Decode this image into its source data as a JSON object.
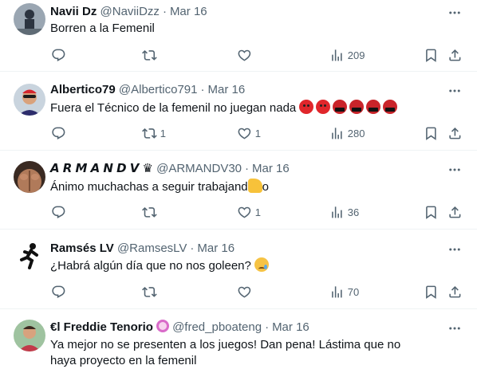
{
  "tweets": [
    {
      "name": "Navii Dz",
      "handle": "@NaviiDzz",
      "date": "Mar 16",
      "text": "Borren a la Femenil",
      "stats": {
        "replies": "",
        "retweets": "",
        "likes": "",
        "views": "209"
      },
      "avatar_colors": [
        "#7d8a98",
        "#2c3440"
      ]
    },
    {
      "name": "Albertico79",
      "handle": "@Albertico791",
      "date": "Mar 16",
      "text": "Fuera el Técnico de la femenil no juegan nada",
      "emojis": [
        "angry-face",
        "angry-face",
        "cursing-face",
        "cursing-face",
        "cursing-face",
        "cursing-face"
      ],
      "stats": {
        "replies": "",
        "retweets": "1",
        "likes": "1",
        "views": "280"
      },
      "avatar_colors": [
        "#c9d4de",
        "#2c2c6b"
      ]
    },
    {
      "name": "𝘼 𝙍 𝙈 𝘼 𝙉 𝘿 𝙑 ♛",
      "handle": "@ARMANDV30",
      "date": "Mar 16",
      "text_before": "Ánimo muchachas a seguir trabajand",
      "text_after": "o",
      "stats": {
        "replies": "",
        "retweets": "",
        "likes": "1",
        "views": "36"
      },
      "avatar_colors": [
        "#b07a5a",
        "#3a2a22"
      ]
    },
    {
      "name": "Ramsés LV",
      "handle": "@RamsesLV",
      "date": "Mar 16",
      "text": "¿Habrá algún día que no nos goleen?",
      "stats": {
        "replies": "",
        "retweets": "",
        "likes": "",
        "views": "70"
      },
      "avatar_colors": [
        "#ffffff",
        "#111111"
      ]
    },
    {
      "name": "€l Freddie Tenorio",
      "handle": "@fred_pboateng",
      "date": "Mar 16",
      "text": "Ya mejor no se presenten a los juegos! Dan pena! Lástima que no haya proyecto en la femenil",
      "stats": {
        "replies": "",
        "retweets": "",
        "likes": "",
        "views": ""
      },
      "avatar_colors": [
        "#9fc3a0",
        "#c23a4a"
      ]
    }
  ],
  "colors": {
    "secondary_text": "#536471",
    "divider": "#eff3f4",
    "text": "#0f1419"
  }
}
